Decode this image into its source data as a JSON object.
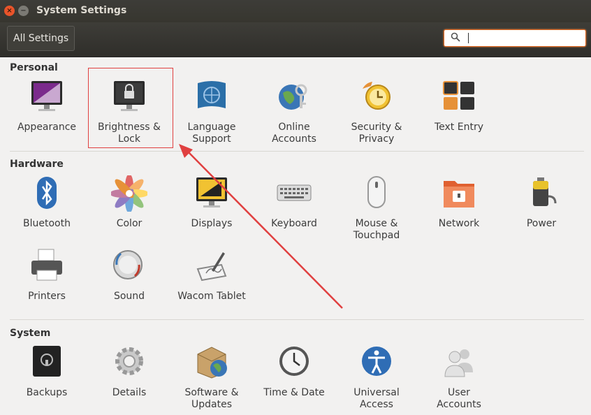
{
  "window": {
    "title": "System Settings",
    "close_glyph": "×",
    "minimize_glyph": "−"
  },
  "toolbar": {
    "all_settings": "All Settings",
    "search_value": ""
  },
  "sections": {
    "personal": {
      "title": "Personal",
      "items": [
        {
          "label": "Appearance",
          "icon": "appearance-icon"
        },
        {
          "label": "Brightness &\nLock",
          "icon": "brightness-lock-icon"
        },
        {
          "label": "Language\nSupport",
          "icon": "language-support-icon"
        },
        {
          "label": "Online\nAccounts",
          "icon": "online-accounts-icon"
        },
        {
          "label": "Security &\nPrivacy",
          "icon": "security-privacy-icon"
        },
        {
          "label": "Text Entry",
          "icon": "text-entry-icon"
        }
      ]
    },
    "hardware": {
      "title": "Hardware",
      "items": [
        {
          "label": "Bluetooth",
          "icon": "bluetooth-icon"
        },
        {
          "label": "Color",
          "icon": "color-icon"
        },
        {
          "label": "Displays",
          "icon": "displays-icon"
        },
        {
          "label": "Keyboard",
          "icon": "keyboard-icon"
        },
        {
          "label": "Mouse &\nTouchpad",
          "icon": "mouse-touchpad-icon"
        },
        {
          "label": "Network",
          "icon": "network-icon"
        },
        {
          "label": "Power",
          "icon": "power-icon"
        },
        {
          "label": "Printers",
          "icon": "printers-icon"
        },
        {
          "label": "Sound",
          "icon": "sound-icon"
        },
        {
          "label": "Wacom Tablet",
          "icon": "wacom-tablet-icon"
        }
      ]
    },
    "system": {
      "title": "System",
      "items": [
        {
          "label": "Backups",
          "icon": "backups-icon"
        },
        {
          "label": "Details",
          "icon": "details-icon"
        },
        {
          "label": "Software &\nUpdates",
          "icon": "software-updates-icon"
        },
        {
          "label": "Time & Date",
          "icon": "time-date-icon"
        },
        {
          "label": "Universal\nAccess",
          "icon": "universal-access-icon"
        },
        {
          "label": "User\nAccounts",
          "icon": "user-accounts-icon"
        }
      ]
    }
  },
  "annotation": {
    "color": "#e04040"
  }
}
